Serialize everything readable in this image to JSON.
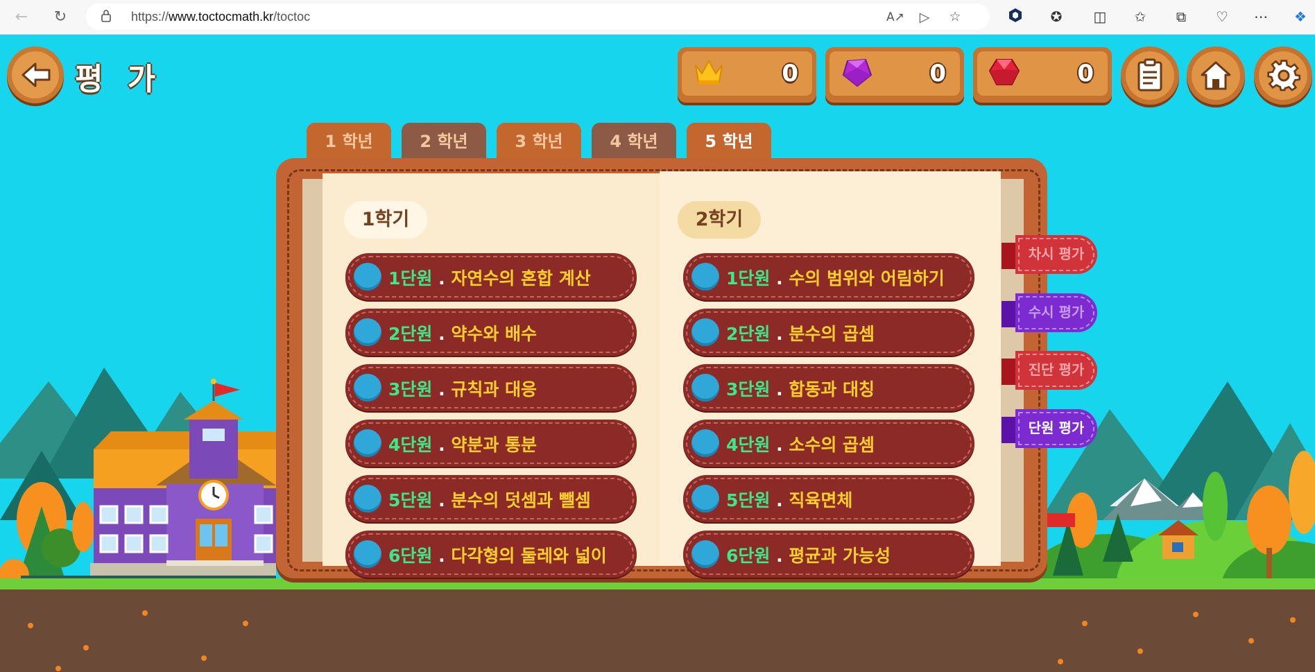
{
  "browser": {
    "url": "https://www.toctocmath.kr/toctoc",
    "url_host_bold": "www.toctocmath.kr",
    "url_prefix": "https://",
    "url_path": "/toctoc"
  },
  "header": {
    "title": "평 가",
    "resources": [
      {
        "name": "crown",
        "value": "0"
      },
      {
        "name": "purple-gem",
        "value": "0"
      },
      {
        "name": "red-gem",
        "value": "0"
      }
    ]
  },
  "grade_tabs": [
    {
      "label": "1 학년",
      "active": false,
      "color": "#c3672f"
    },
    {
      "label": "2 학년",
      "active": false,
      "color": "#8d5b45"
    },
    {
      "label": "3 학년",
      "active": false,
      "color": "#c3672f"
    },
    {
      "label": "4 학년",
      "active": false,
      "color": "#8d5b45"
    },
    {
      "label": "5 학년",
      "active": true,
      "color": "#c3672f"
    }
  ],
  "semesters": [
    {
      "label": "1학기",
      "units": [
        {
          "num": "1단원",
          "name": "자연수의 혼합 계산"
        },
        {
          "num": "2단원",
          "name": "약수와 배수"
        },
        {
          "num": "3단원",
          "name": "규칙과 대응"
        },
        {
          "num": "4단원",
          "name": "약분과 통분"
        },
        {
          "num": "5단원",
          "name": "분수의 덧셈과 뺄셈"
        },
        {
          "num": "6단원",
          "name": "다각형의 둘레와 넓이"
        }
      ]
    },
    {
      "label": "2학기",
      "units": [
        {
          "num": "1단원",
          "name": "수의 범위와 어림하기"
        },
        {
          "num": "2단원",
          "name": "분수의 곱셈"
        },
        {
          "num": "3단원",
          "name": "합동과 대칭"
        },
        {
          "num": "4단원",
          "name": "소수의 곱셈"
        },
        {
          "num": "5단원",
          "name": "직육면체"
        },
        {
          "num": "6단원",
          "name": "평균과 가능성"
        }
      ]
    }
  ],
  "unit_separator": ".",
  "side_tabs": [
    {
      "label": "차시 평가",
      "color": "#d1333b",
      "tail": "#a8151c",
      "text_color": "#f3a6a8"
    },
    {
      "label": "수시 평가",
      "color": "#7b2bd0",
      "tail": "#5a12a8",
      "text_color": "#c69bf0"
    },
    {
      "label": "진단 평가",
      "color": "#d1333b",
      "tail": "#a8151c",
      "text_color": "#f3a6a8"
    },
    {
      "label": "단원 평가",
      "color": "#7b2bd0",
      "tail": "#5a12a8",
      "text_color": "#ffffff"
    }
  ],
  "colors": {
    "sky": "#17d5ec",
    "unit_number": "#3be98c",
    "unit_name": "#ffcf2a",
    "unit_bg": "#8b2a27"
  }
}
